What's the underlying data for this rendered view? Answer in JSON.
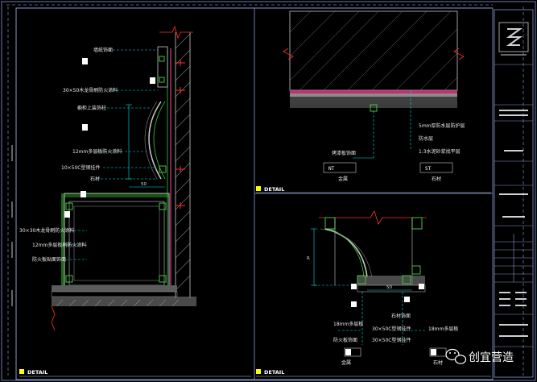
{
  "drawing": {
    "detail_label": "DETAIL",
    "panel_a": {
      "callouts": [
        "墙纸饰面",
        "30×50木龙骨刷防火涂料",
        "橱柜上装饰柱",
        "12mm多层板防火涂料",
        "10×50C型钢挂件",
        "石材",
        "30×30木龙骨刷防火涂料",
        "12mm多层板刷防火涂料",
        "防火板贴面饰面"
      ],
      "dim": "50"
    },
    "panel_b": {
      "callouts_right": [
        "5mm厚防水层防护层",
        "防水层",
        "1:3水泥砂浆找平层"
      ],
      "callout_left": "烤漆板饰面",
      "tag_left": "NT",
      "tag_left_caption": "金属",
      "tag_right": "ST",
      "tag_right_caption": "石材"
    },
    "panel_c": {
      "dim_left": "R",
      "dim_bottom": "50",
      "callouts": [
        "石材饰面",
        "30×50C型钢挂件",
        "18mm多层板",
        "18mm多层板",
        "30×50C型钢挂件",
        "防火板饰面"
      ],
      "tag_left_caption": "金属",
      "tag_right_caption": "石材"
    },
    "title_block": {
      "logo": "company-logo"
    }
  },
  "watermark": {
    "text": "创宜营造",
    "icon": "wechat-icon"
  },
  "colors": {
    "frame": "#5a6f9a",
    "dim": "#00e0e0",
    "wall": "#3cc63c",
    "section": "#e03a8a",
    "red": "#ff3030",
    "white": "#ffffff",
    "yellow": "#ffff00"
  }
}
